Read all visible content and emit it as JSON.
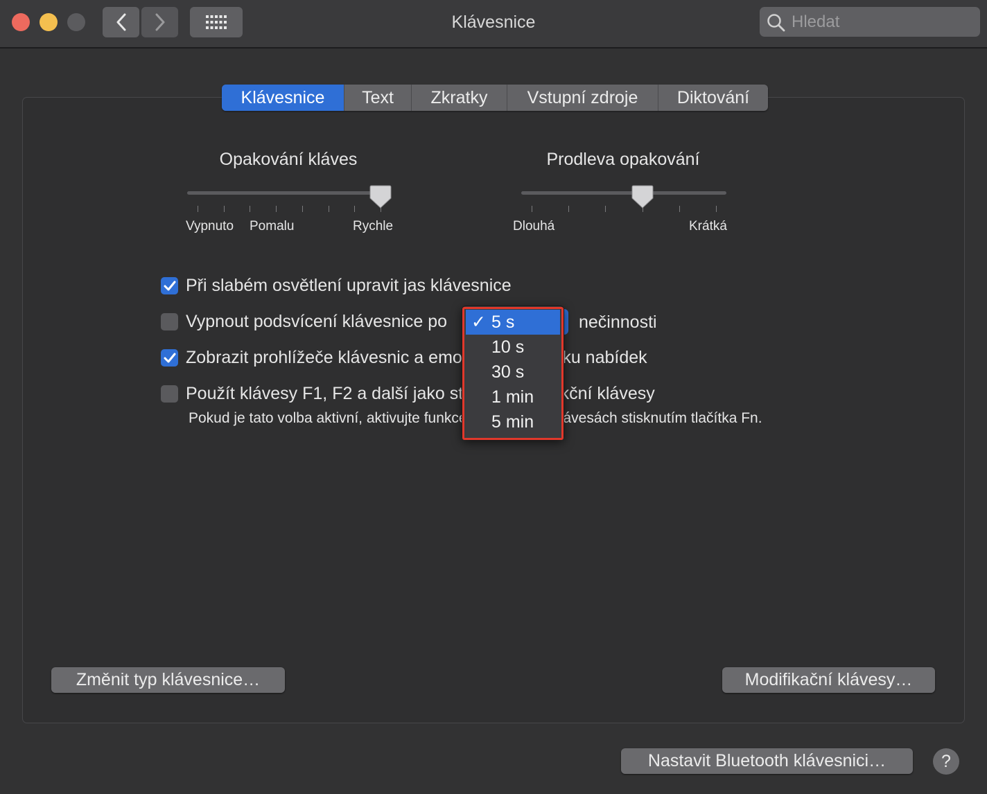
{
  "window": {
    "title": "Klávesnice"
  },
  "search": {
    "placeholder": "Hledat"
  },
  "tabs": [
    {
      "label": "Klávesnice",
      "active": true
    },
    {
      "label": "Text",
      "active": false
    },
    {
      "label": "Zkratky",
      "active": false
    },
    {
      "label": "Vstupní zdroje",
      "active": false
    },
    {
      "label": "Diktování",
      "active": false
    }
  ],
  "key_repeat": {
    "title": "Opakování kláves",
    "label_off": "Vypnuto",
    "label_slow": "Pomalu",
    "label_fast": "Rychle",
    "value_fraction": 1.0
  },
  "repeat_delay": {
    "title": "Prodleva opakování",
    "label_long": "Dlouhá",
    "label_short": "Krátká",
    "value_fraction": 0.6
  },
  "options": {
    "brightness": {
      "label": "Při slabém osvětlení upravit jas klávesnice",
      "checked": true
    },
    "backlight": {
      "label": "Vypnout podsvícení klávesnice po",
      "after": "nečinnosti",
      "checked": false
    },
    "viewers": {
      "label": "Zobrazit prohlížeče klávesnic a emotikonů na řádku nabídek",
      "checked": true
    },
    "fkeys": {
      "label": "Použít klávesy F1, F2 a další jako standardní funkční klávesy",
      "checked": false
    },
    "fkeys_note": "Pokud je tato volba aktivní, aktivujte funkce vytištěné na klávesách stisknutím tlačítka Fn."
  },
  "dropdown": {
    "options": [
      "5 s",
      "10 s",
      "30 s",
      "1 min",
      "5 min"
    ],
    "selected": "5 s",
    "check_glyph": "✓"
  },
  "buttons": {
    "change_type": "Změnit typ klávesnice…",
    "modifier": "Modifikační klávesy…",
    "bluetooth": "Nastavit Bluetooth klávesnici…",
    "help": "?"
  },
  "colors": {
    "accent": "#2f6fd6",
    "highlight": "#e1382b"
  }
}
